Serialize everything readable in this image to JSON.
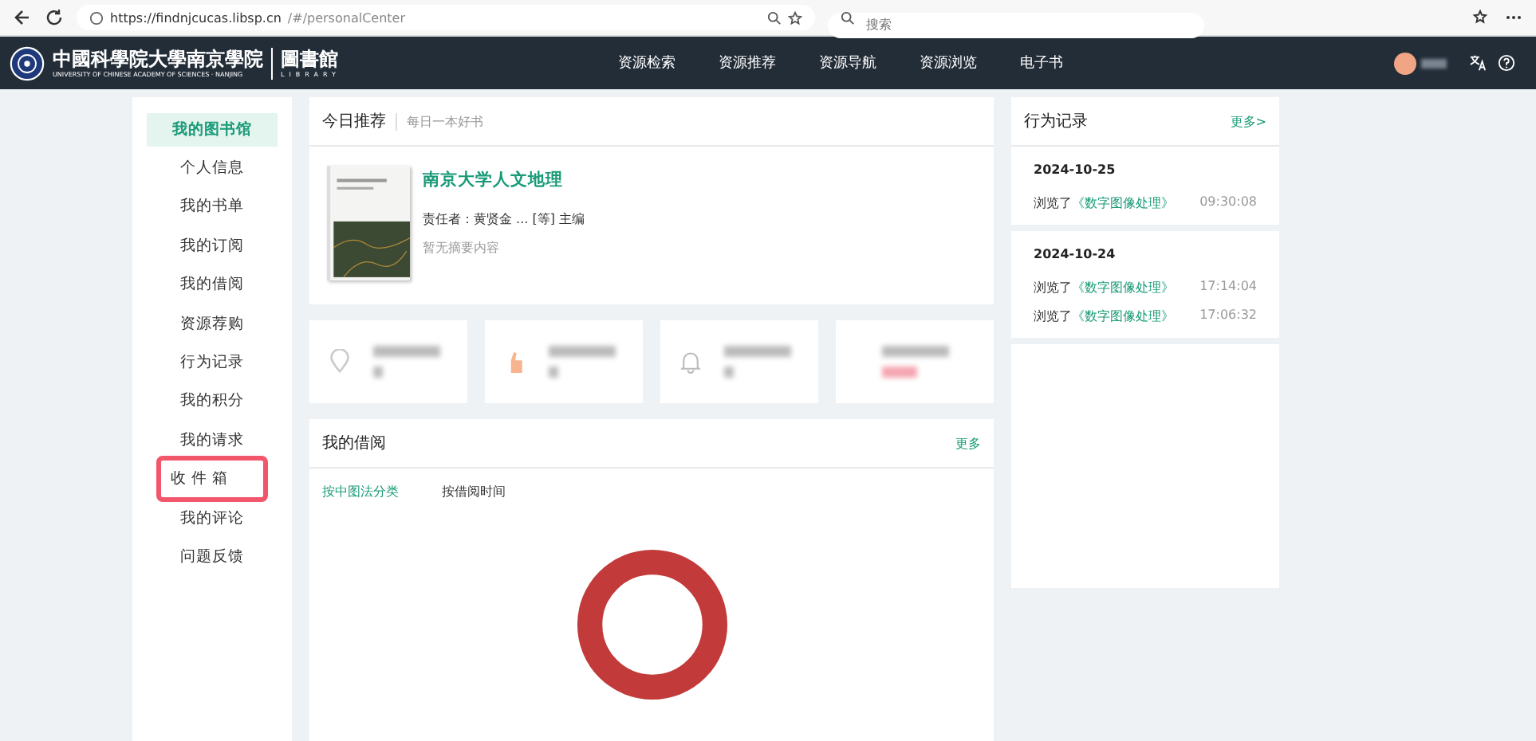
{
  "browser": {
    "url_host": "https://findnjcucas.libsp.cn",
    "url_path": "/#/personalCenter",
    "search_placeholder": "搜索"
  },
  "header": {
    "logo_cn": "中國科學院大學南京學院",
    "logo_en": "UNIVERSITY OF CHINESE ACADEMY OF SCIENCES · NANJING",
    "library_cn": "圖書館",
    "library_en": "LIBRARY",
    "nav": [
      "资源检索",
      "资源推荐",
      "资源导航",
      "资源浏览",
      "电子书"
    ]
  },
  "sidebar": {
    "items": [
      {
        "label": "我的图书馆",
        "selected": true,
        "highlighted": false
      },
      {
        "label": "个人信息",
        "selected": false,
        "highlighted": false
      },
      {
        "label": "我的书单",
        "selected": false,
        "highlighted": false
      },
      {
        "label": "我的订阅",
        "selected": false,
        "highlighted": false
      },
      {
        "label": "我的借阅",
        "selected": false,
        "highlighted": false
      },
      {
        "label": "资源荐购",
        "selected": false,
        "highlighted": false
      },
      {
        "label": "行为记录",
        "selected": false,
        "highlighted": false
      },
      {
        "label": "我的积分",
        "selected": false,
        "highlighted": false
      },
      {
        "label": "我的请求",
        "selected": false,
        "highlighted": false
      },
      {
        "label": "收 件 箱",
        "selected": false,
        "highlighted": true
      },
      {
        "label": "我的评论",
        "selected": false,
        "highlighted": false
      },
      {
        "label": "问题反馈",
        "selected": false,
        "highlighted": false
      }
    ]
  },
  "recommend": {
    "title": "今日推荐",
    "subtitle": "每日一本好书",
    "book_title": "南京大学人文地理",
    "author": "责任者：黄贤金 ... [等] 主编",
    "abstract": "暂无摘要内容"
  },
  "stats": [
    {
      "kind": "location"
    },
    {
      "kind": "hand"
    },
    {
      "kind": "bell"
    },
    {
      "kind": "plain"
    }
  ],
  "borrow": {
    "title": "我的借阅",
    "more": "更多",
    "tabs": [
      {
        "label": "按中图法分类",
        "selected": true
      },
      {
        "label": "按借阅时间",
        "selected": false
      }
    ]
  },
  "activity": {
    "title": "行为记录",
    "more": "更多>",
    "groups": [
      {
        "date": "2024-10-25",
        "entries": [
          {
            "action": "浏览了",
            "book": "《数字图像处理》",
            "time": "09:30:08"
          }
        ]
      },
      {
        "date": "2024-10-24",
        "entries": [
          {
            "action": "浏览了",
            "book": "《数字图像处理》",
            "time": "17:14:04"
          },
          {
            "action": "浏览了",
            "book": "《数字图像处理》",
            "time": "17:06:32"
          }
        ]
      }
    ]
  }
}
